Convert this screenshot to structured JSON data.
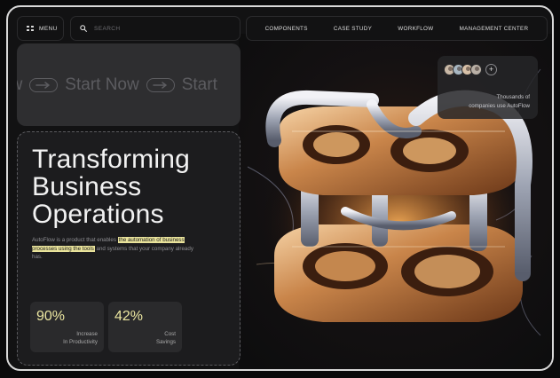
{
  "nav": {
    "menu_label": "MENU",
    "search_placeholder": "SEARCH",
    "links": [
      "COMPONENTS",
      "CASE STUDY",
      "WORKFLOW",
      "MANAGEMENT CENTER"
    ]
  },
  "marquee": {
    "fragments": [
      "ow",
      "Start Now",
      "Start"
    ]
  },
  "hero": {
    "title": [
      "Transforming",
      "Business",
      "Operations"
    ],
    "desc_parts": [
      "AutoFlow is a product that enables ",
      "the automation of business processes using the tools",
      " and systems that your company already has."
    ]
  },
  "stats": [
    {
      "value": "90%",
      "label_line1": "Increase",
      "label_line2": "In Productivity"
    },
    {
      "value": "42%",
      "label_line1": "Cost",
      "label_line2": "Savings"
    }
  ],
  "social_proof": {
    "plus": "+",
    "text_line1": "Thousands of",
    "text_line2": "companies use AutoFlow"
  },
  "colors": {
    "accent_yellow": "#ece7a1",
    "highlight": "#e9e39b",
    "panel": "#1c1c1e",
    "background": "#121213"
  },
  "icons": [
    "menu-grid-icon",
    "search-icon",
    "arrow-right-icon",
    "plus-icon"
  ]
}
